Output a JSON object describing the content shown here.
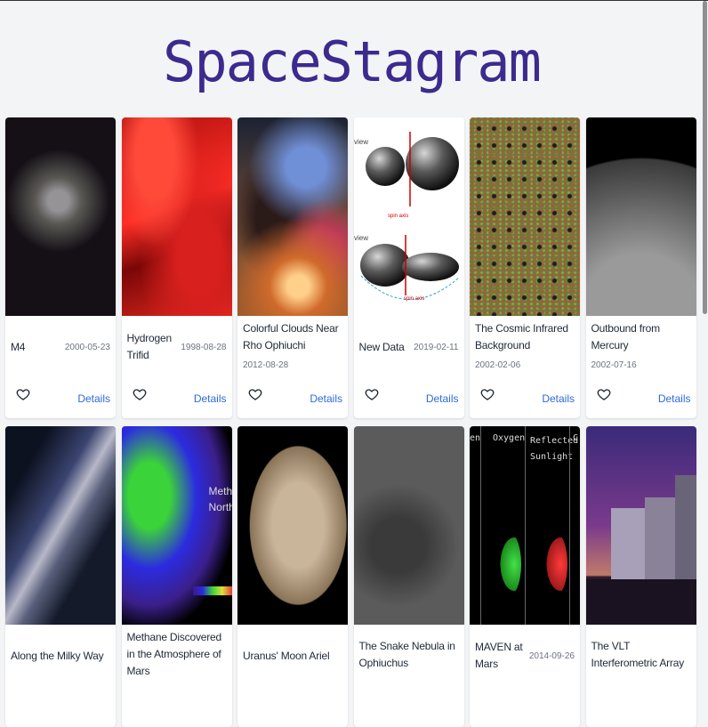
{
  "app": {
    "title": "SpaceStagram"
  },
  "labels": {
    "details": "Details"
  },
  "cards": [
    {
      "title": "M4",
      "date": "2000-05-23",
      "layout": "inline",
      "art": "stars"
    },
    {
      "title": "Hydrogen Trifid",
      "date": "1998-08-28",
      "layout": "inline",
      "art": "red-neb"
    },
    {
      "title": "Colorful Clouds Near Rho Ophiuchi",
      "date": "2012-08-28",
      "layout": "stack",
      "art": "rho"
    },
    {
      "title": "New Data",
      "date": "2019-02-11",
      "layout": "inline",
      "art": "newdata",
      "image_text": {
        "top": "view",
        "bottom": "view",
        "axis1": "spin axis",
        "axis2": "spin axis"
      }
    },
    {
      "title": "The Cosmic Infrared Background",
      "date": "2002-02-06",
      "layout": "stack",
      "art": "cib"
    },
    {
      "title": "Outbound from Mercury",
      "date": "2002-07-16",
      "layout": "stack",
      "art": "mercury"
    },
    {
      "title": "Along the Milky Way",
      "date": "",
      "layout": "inline",
      "art": "milky"
    },
    {
      "title": "Methane Discovered in the Atmosphere of Mars",
      "date": "",
      "layout": "stack",
      "art": "methane",
      "image_text": {
        "line1": "Metha",
        "line2": "Northe"
      }
    },
    {
      "title": "Uranus' Moon Ariel",
      "date": "",
      "layout": "inline",
      "art": "ariel"
    },
    {
      "title": "The Snake Nebula in Ophiuchus",
      "date": "",
      "layout": "stack",
      "art": "snake"
    },
    {
      "title": "MAVEN at Mars",
      "date": "2014-09-26",
      "layout": "inline",
      "art": "maven",
      "image_text": {
        "left": "en",
        "oxygen": "Oxygen",
        "reflected": "Reflected Sunlight",
        "right": "C"
      }
    },
    {
      "title": "The VLT Interferometric Array",
      "date": "",
      "layout": "stack",
      "art": "vlt"
    }
  ],
  "colors": {
    "title": "#3d2a8e",
    "link": "#2d6bd8",
    "background": "#f3f4f6"
  }
}
